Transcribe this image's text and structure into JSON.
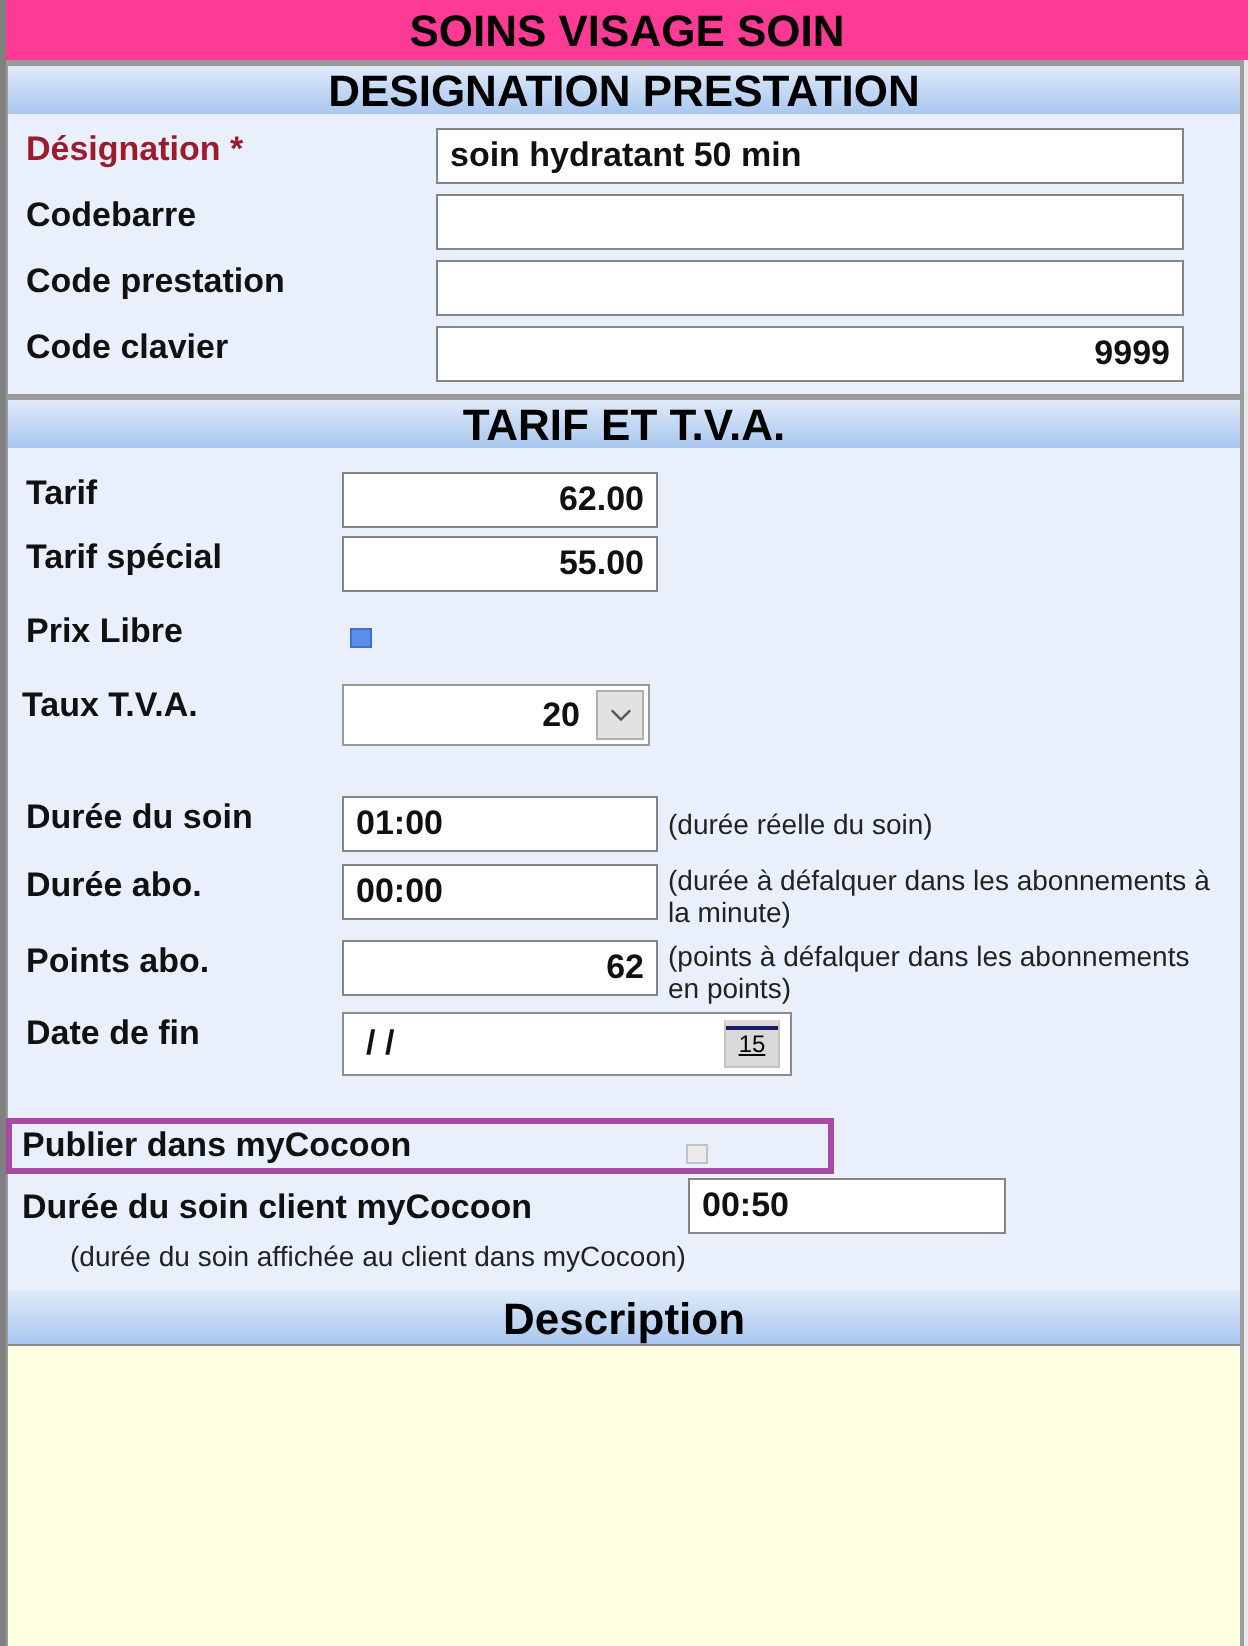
{
  "title": "SOINS VISAGE SOIN",
  "designation": {
    "heading": "DESIGNATION PRESTATION",
    "fields": [
      {
        "label": "Désignation *",
        "required": true,
        "kind": "text",
        "value": "soin hydratant 50 min"
      },
      {
        "label": "Codebarre",
        "required": false,
        "kind": "text"
      },
      {
        "label": "Code prestation",
        "required": false,
        "kind": "text"
      },
      {
        "label": "Code clavier",
        "required": false,
        "kind": "number",
        "value": "9999"
      }
    ]
  },
  "tarif": {
    "heading": "TARIF ET T.V.A.",
    "rows": [
      {
        "kind": "number",
        "label": "Tarif",
        "value": "62.00"
      },
      {
        "kind": "number",
        "label": "Tarif spécial",
        "value": "55.00"
      },
      {
        "kind": "checkbox",
        "label": "Prix Libre",
        "checked": true
      },
      {
        "kind": "select",
        "label": "Taux T.V.A.",
        "value": "20"
      },
      {
        "kind": "time",
        "label": "Durée du soin",
        "value": "01:00",
        "note": "(durée réelle du soin)"
      },
      {
        "kind": "time",
        "label": "Durée abo.",
        "value": "00:00",
        "note": "(durée à défalquer dans les abonnements à la minute)"
      },
      {
        "kind": "number",
        "label": "Points abo.",
        "value": "62",
        "note": "(points à défalquer dans les abonnements en points)"
      },
      {
        "kind": "date",
        "label": "Date de fin",
        "value": "/ /",
        "calendar": "15"
      }
    ]
  },
  "mycocoon": {
    "publish": {
      "label": "Publier dans myCocoon",
      "checked": false,
      "disabled": true,
      "highlighted": true
    },
    "duration": {
      "label": "Durée du soin client myCocoon",
      "value": "00:50",
      "note": "(durée du soin affichée au client dans myCocoon)"
    }
  },
  "description": {
    "heading": "Description"
  }
}
